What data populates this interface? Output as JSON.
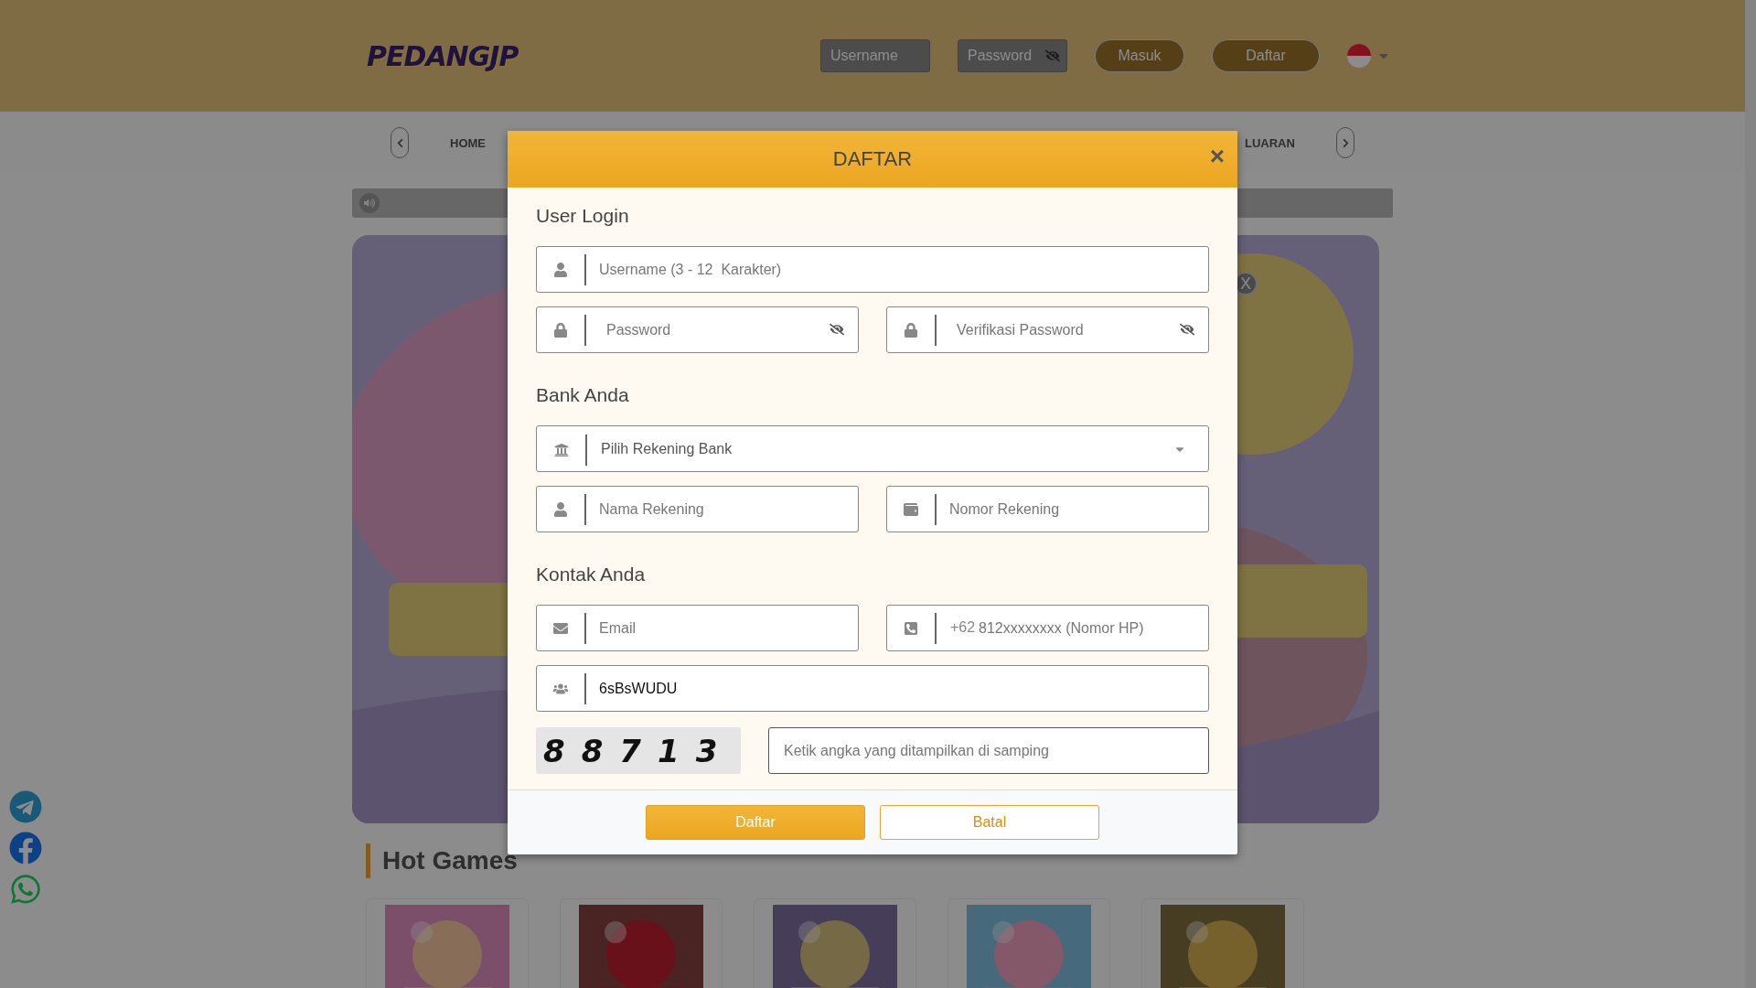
{
  "header": {
    "logo": "PEDANGJP",
    "username_placeholder": "Username",
    "password_placeholder": "Password",
    "password_toggle": true,
    "buttons": [
      "Masuk",
      "Daftar"
    ]
  },
  "nav": {
    "items": [
      "HOME",
      "LUARAN"
    ]
  },
  "banner": {
    "kind": "picture",
    "close": "X"
  },
  "hot_games": {
    "title": "Hot Games"
  },
  "modal": {
    "title": "DAFTAR",
    "close": "×",
    "sections": [
      {
        "title": "User Login",
        "rows": [
          [
            {
              "kind": "username",
              "placeholder": "Username (3 - 12  Karakter)"
            }
          ],
          [
            {
              "kind": "password",
              "placeholder": "Password",
              "password_toggle": true
            },
            {
              "kind": "password",
              "placeholder": "Verifikasi Password",
              "password_toggle": true
            }
          ]
        ]
      },
      {
        "title": "Bank Anda",
        "rows": [
          [
            {
              "kind": "bank",
              "placeholder": "Pilih Rekening Bank"
            }
          ],
          [
            {
              "kind": "username",
              "placeholder": "Nama Rekening"
            },
            {
              "kind": "account",
              "placeholder": "Nomor Rekening"
            }
          ]
        ]
      },
      {
        "title": "Kontak Anda",
        "rows": [
          [
            {
              "kind": "email",
              "placeholder": "Email"
            },
            {
              "kind": "phone",
              "prefix": "+62",
              "placeholder": "812xxxxxxxx (Nomor HP)"
            }
          ],
          [
            {
              "kind": "referral",
              "value": "6sBsWUDU"
            }
          ],
          [
            {
              "kind": "captcha",
              "code": "88713",
              "placeholder": "Ketik angka yang ditampilkan di samping"
            }
          ]
        ]
      }
    ],
    "buttons": [
      {
        "label": "Daftar",
        "kind": "primary"
      },
      {
        "label": "Batal",
        "kind": "secondary"
      }
    ]
  }
}
